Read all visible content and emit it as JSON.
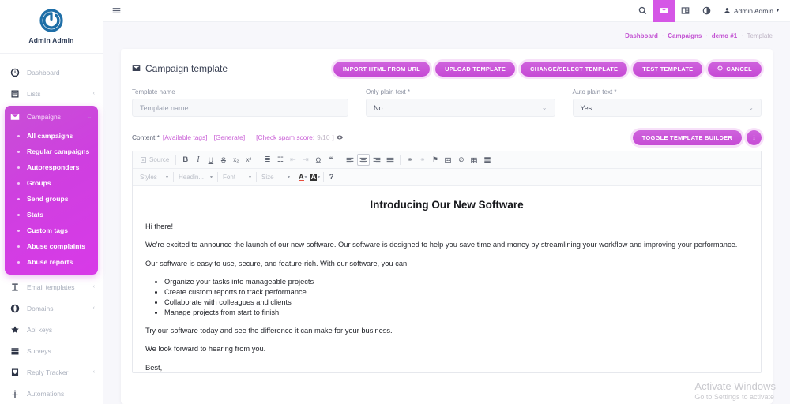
{
  "brand": {
    "name": "Admin Admin",
    "logo_icon": "power-circle-logo"
  },
  "sidebar": {
    "items": [
      {
        "label": "Dashboard",
        "icon": "dashboard-clock-icon",
        "caret": ""
      },
      {
        "label": "Lists",
        "icon": "list-box-icon",
        "caret": "‹"
      },
      {
        "label": "Email templates",
        "icon": "text-format-icon",
        "caret": "‹"
      },
      {
        "label": "Domains",
        "icon": "globe-icon",
        "caret": "‹"
      },
      {
        "label": "Api keys",
        "icon": "star-icon",
        "caret": ""
      },
      {
        "label": "Surveys",
        "icon": "survey-lines-icon",
        "caret": ""
      },
      {
        "label": "Reply Tracker",
        "icon": "inbox-icon",
        "caret": "‹"
      },
      {
        "label": "Automations",
        "icon": "automation-node-icon",
        "caret": ""
      }
    ],
    "campaigns": {
      "label": "Campaigns",
      "icon": "envelope-icon",
      "caret": "⌄",
      "children": [
        "All campaigns",
        "Regular campaigns",
        "Autoresponders",
        "Groups",
        "Send groups",
        "Stats",
        "Custom tags",
        "Abuse complaints",
        "Abuse reports"
      ]
    }
  },
  "topbar": {
    "menu_icon": "hamburger-icon",
    "actions": [
      {
        "icon": "search-icon",
        "name": "search"
      },
      {
        "icon": "envelope-icon",
        "name": "messages"
      },
      {
        "icon": "news-icon",
        "name": "news"
      },
      {
        "icon": "contrast-icon",
        "name": "theme-toggle"
      }
    ],
    "user": "Admin Admin",
    "user_caret": "▾"
  },
  "breadcrumb": {
    "items": [
      "Dashboard",
      "Campaigns",
      "demo #1"
    ],
    "current": "Template",
    "separator": "·"
  },
  "page": {
    "title": "Campaign template",
    "title_icon": "envelope-icon",
    "actions": [
      {
        "label": "IMPORT HTML FROM URL",
        "icon": ""
      },
      {
        "label": "UPLOAD TEMPLATE",
        "icon": ""
      },
      {
        "label": "CHANGE/SELECT TEMPLATE",
        "icon": ""
      },
      {
        "label": "TEST TEMPLATE",
        "icon": ""
      },
      {
        "label": "CANCEL",
        "icon": "cancel-circle-icon"
      }
    ]
  },
  "form": {
    "template_name": {
      "label": "Template name",
      "placeholder": "Template name",
      "value": ""
    },
    "only_plain_text": {
      "label": "Only plain text *",
      "value": "No",
      "chev": "⌄"
    },
    "auto_plain_text": {
      "label": "Auto plain text *",
      "value": "Yes",
      "chev": "⌄"
    }
  },
  "content_bar": {
    "label": "Content *",
    "available_tags": "[Available tags]",
    "generate": "[Generate]",
    "spam_prefix": "[Check spam score:",
    "spam_score": "9/10",
    "spam_suffix": "]",
    "eye_icon": "eye-icon",
    "toggle_builder": "TOGGLE TEMPLATE BUILDER",
    "info_label": "i"
  },
  "editor": {
    "source_label": "Source",
    "row1": [
      {
        "name": "bold",
        "glyph": "B",
        "cls": "bold"
      },
      {
        "name": "italic",
        "glyph": "I",
        "cls": "ital"
      },
      {
        "name": "underline",
        "glyph": "U",
        "cls": "under"
      },
      {
        "name": "strikethrough",
        "glyph": "S",
        "cls": "strike"
      },
      {
        "name": "subscript",
        "glyph": "x₂",
        "cls": ""
      },
      {
        "name": "superscript",
        "glyph": "x²",
        "cls": ""
      },
      {
        "name": "numbered-list",
        "glyph": "≣",
        "cls": ""
      },
      {
        "name": "bulleted-list",
        "glyph": "☷",
        "cls": ""
      },
      {
        "name": "decrease-indent",
        "glyph": "⇤",
        "cls": "dim"
      },
      {
        "name": "increase-indent",
        "glyph": "⇥",
        "cls": "dim"
      },
      {
        "name": "special-character",
        "glyph": "Ω",
        "cls": ""
      },
      {
        "name": "blockquote",
        "glyph": "❝",
        "cls": ""
      },
      {
        "name": "align-left",
        "glyph": "≡",
        "cls": ""
      },
      {
        "name": "align-center",
        "glyph": "≡",
        "cls": "on"
      },
      {
        "name": "align-right",
        "glyph": "≡",
        "cls": ""
      },
      {
        "name": "justify",
        "glyph": "≡",
        "cls": ""
      },
      {
        "name": "link",
        "glyph": "⚭",
        "cls": ""
      },
      {
        "name": "unlink",
        "glyph": "⚭",
        "cls": "dim"
      },
      {
        "name": "anchor",
        "glyph": "⚑",
        "cls": ""
      },
      {
        "name": "image",
        "glyph": "⛰",
        "cls": ""
      },
      {
        "name": "remove-format",
        "glyph": "⊘",
        "cls": ""
      },
      {
        "name": "table",
        "glyph": "▦",
        "cls": ""
      },
      {
        "name": "page-break",
        "glyph": "☰",
        "cls": ""
      }
    ],
    "row2_combos": [
      {
        "name": "styles",
        "label": "Styles",
        "caret": "▾"
      },
      {
        "name": "format",
        "label": "Headin...",
        "caret": "▾"
      },
      {
        "name": "font",
        "label": "Font",
        "caret": "▾"
      },
      {
        "name": "size",
        "label": "Size",
        "caret": "▾"
      }
    ],
    "row2_colors": [
      {
        "name": "text-color",
        "glyph": "A",
        "caret": "▾"
      },
      {
        "name": "background-color",
        "glyph": "A",
        "caret": "▾"
      }
    ],
    "help_glyph": "?"
  },
  "document": {
    "heading": "Introducing Our New Software",
    "paragraphs": [
      "Hi there!",
      "We're excited to announce the launch of our new software. Our software is designed to help you save time and money by streamlining your workflow and improving your performance.",
      "Our software is easy to use, secure, and feature-rich. With our software, you can:"
    ],
    "bullets": [
      "Organize your tasks into manageable projects",
      "Create custom reports to track performance",
      "Collaborate with colleagues and clients",
      "Manage projects from start to finish"
    ],
    "closing": [
      "Try our software today and see the difference it can make for your business.",
      "We look forward to hearing from you.",
      "Best,"
    ]
  },
  "watermark": {
    "line1": "Activate Windows",
    "line2": "Go to Settings to activate"
  }
}
